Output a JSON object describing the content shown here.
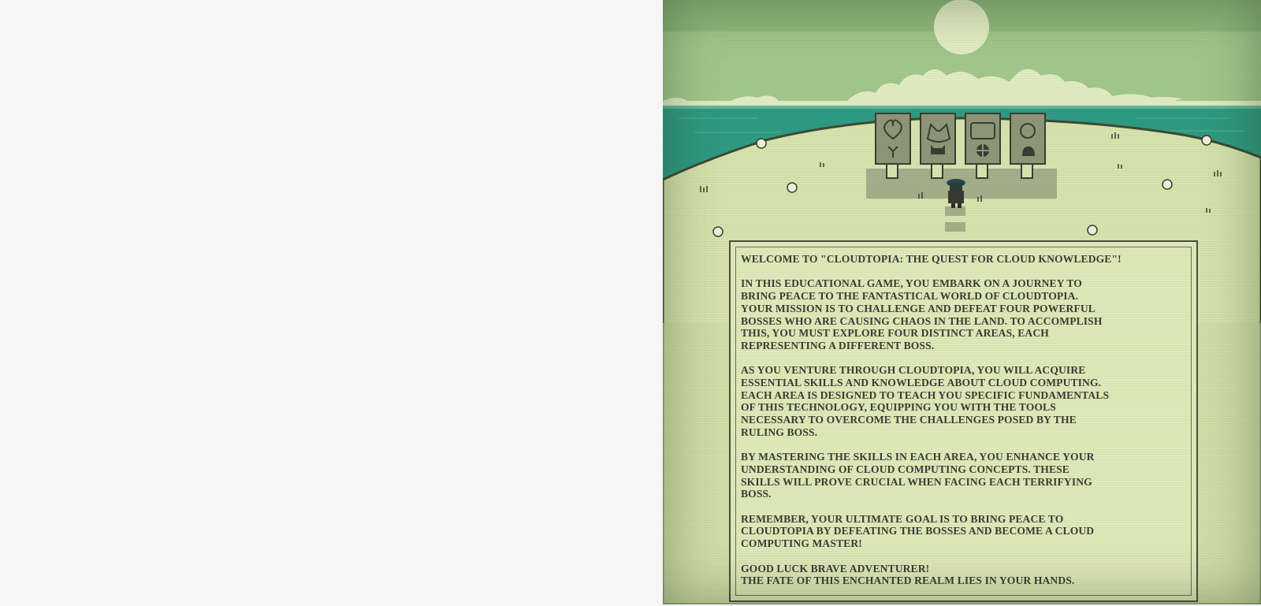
{
  "game": {
    "title": "Cloudtopia: The Quest for Cloud Knowledge",
    "signs": [
      {
        "name": "boss-sign-heart",
        "icon": "heart-icon",
        "emblem": "lobster-icon"
      },
      {
        "name": "boss-sign-wolf",
        "icon": "wolf-icon",
        "emblem": "demon-icon"
      },
      {
        "name": "boss-sign-screen",
        "icon": "screen-icon",
        "emblem": "crosshair-icon"
      },
      {
        "name": "boss-sign-sun",
        "icon": "sun-icon",
        "emblem": "bird-icon"
      }
    ],
    "player": {
      "icon": "player-character-icon"
    },
    "colors": {
      "sky": "#9fc48a",
      "sea": "#2f9a82",
      "sand": "#d6e3ad",
      "text": "#3b3d34",
      "panel": "#dfe8b8"
    }
  },
  "dialog": {
    "lines": [
      "WELCOME TO \"CLOUDTOPIA: THE QUEST FOR CLOUD KNOWLEDGE\"!",
      "",
      "IN THIS EDUCATIONAL GAME, YOU EMBARK ON A JOURNEY TO",
      "BRING PEACE TO THE FANTASTICAL WORLD OF CLOUDTOPIA.",
      "YOUR MISSION IS TO CHALLENGE AND DEFEAT FOUR POWERFUL",
      "BOSSES WHO ARE CAUSING CHAOS IN THE LAND. TO ACCOMPLISH",
      "THIS, YOU MUST EXPLORE FOUR DISTINCT AREAS, EACH",
      "REPRESENTING A DIFFERENT BOSS.",
      "",
      "AS YOU VENTURE THROUGH CLOUDTOPIA, YOU WILL ACQUIRE",
      "ESSENTIAL SKILLS AND KNOWLEDGE ABOUT CLOUD COMPUTING.",
      "EACH AREA IS DESIGNED TO TEACH YOU SPECIFIC FUNDAMENTALS",
      "OF THIS TECHNOLOGY, EQUIPPING YOU WITH THE TOOLS",
      "NECESSARY TO OVERCOME THE CHALLENGES POSED BY THE",
      "RULING BOSS.",
      "",
      "BY MASTERING THE SKILLS IN EACH AREA, YOU ENHANCE YOUR",
      "UNDERSTANDING OF CLOUD COMPUTING CONCEPTS. THESE",
      "SKILLS WILL PROVE CRUCIAL WHEN FACING EACH TERRIFYING",
      "BOSS.",
      "",
      "REMEMBER, YOUR ULTIMATE GOAL IS TO BRING PEACE TO",
      "CLOUDTOPIA BY DEFEATING THE BOSSES AND BECOME A CLOUD",
      "COMPUTING MASTER!",
      "",
      "GOOD LUCK BRAVE ADVENTURER!",
      "THE FATE OF THIS ENCHANTED REALM LIES IN YOUR HANDS."
    ]
  }
}
